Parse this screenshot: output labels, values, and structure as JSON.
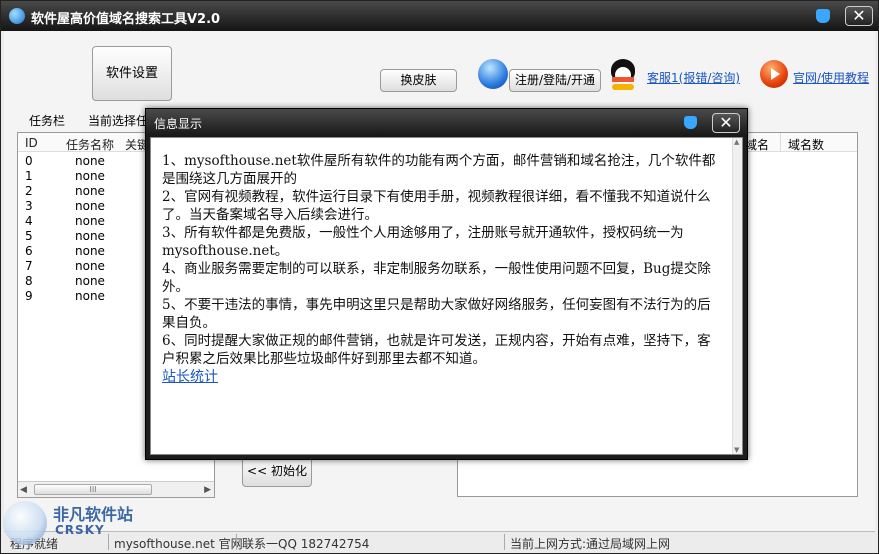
{
  "window": {
    "title": "软件屋高价值域名搜索工具V2.0",
    "close_glyph": "✕"
  },
  "toolbar": {
    "settings_label": "软件设置",
    "skin_label": "换皮肤",
    "register_label": "注册/登陆/开通",
    "service_link": "客服1(报错/咨询)",
    "site_link": "官网/使用教程"
  },
  "tabs": {
    "task_bar": "任务栏",
    "current_select": "当前选择任"
  },
  "task_table": {
    "columns": [
      "ID",
      "任务名称",
      "关键"
    ],
    "rows": [
      {
        "id": "0",
        "name": "none"
      },
      {
        "id": "1",
        "name": "none"
      },
      {
        "id": "2",
        "name": "none"
      },
      {
        "id": "3",
        "name": "none"
      },
      {
        "id": "4",
        "name": "none"
      },
      {
        "id": "5",
        "name": "none"
      },
      {
        "id": "6",
        "name": "none"
      },
      {
        "id": "7",
        "name": "none"
      },
      {
        "id": "8",
        "name": "none"
      },
      {
        "id": "9",
        "name": "none"
      }
    ],
    "scroll_left": "◀",
    "scroll_right": "▶",
    "scroll_thumb": "III"
  },
  "init_button": "<< 初始化",
  "result_table": {
    "columns": [
      "域名",
      "域名数"
    ]
  },
  "status_bar": {
    "ready": "程序就绪",
    "site": "mysofthouse.net 官网",
    "contact": "联系一QQ 182742754",
    "network": "当前上网方式:通过局域网上网"
  },
  "watermark": {
    "name": "非凡软件站",
    "sub": "CRSKY"
  },
  "dialog": {
    "title": "信息显示",
    "close_glyph": "✕",
    "lines": [
      "1、mysofthouse.net软件屋所有软件的功能有两个方面，邮件营销和域名抢注，几个软件都是围绕这几方面展开的",
      "2、官网有视频教程，软件运行目录下有使用手册，视频教程很详细，看不懂我不知道说什么了。当天备案域名导入后续会进行。",
      "3、所有软件都是免费版，一般性个人用途够用了，注册账号就开通软件，授权码统一为mysofthouse.net。",
      "4、商业服务需要定制的可以联系，非定制服务勿联系，一般性使用问题不回复，Bug提交除外。",
      "5、不要干违法的事情，事先申明这里只是帮助大家做好网络服务，任何妄图有不法行为的后果自负。",
      "6、同时提醒大家做正规的邮件营销，也就是许可发送，正规内容，开始有点难，坚持下，客户积累之后效果比那些垃圾邮件好到那里去都不知道。"
    ],
    "stats_link": "站长统计",
    "scroll_up": "▲",
    "scroll_down": "▼"
  }
}
